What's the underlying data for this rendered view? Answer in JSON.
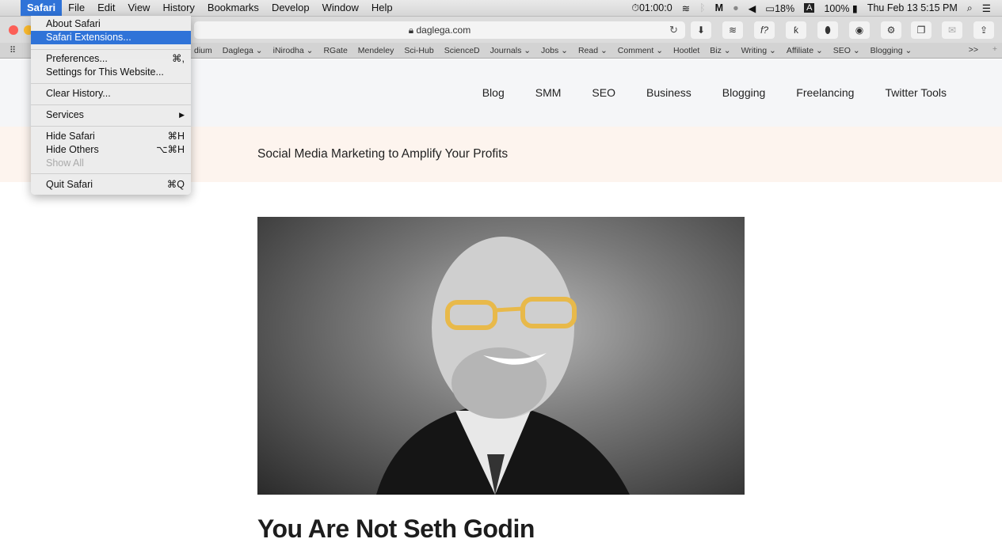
{
  "menubar": {
    "apple": "",
    "items": [
      "Safari",
      "File",
      "Edit",
      "View",
      "History",
      "Bookmarks",
      "Develop",
      "Window",
      "Help"
    ],
    "status": {
      "timer": "01:00:0",
      "cpu": "18%",
      "input": "A",
      "battery": "100%",
      "datetime": "Thu Feb 13  5:15 PM"
    }
  },
  "toolbar": {
    "url": "daglega.com"
  },
  "bookmarks": [
    "dium",
    "Daglega ⌄",
    "iNirodha ⌄",
    "RGate",
    "Mendeley",
    "Sci-Hub",
    "ScienceD",
    "Journals ⌄",
    "Jobs ⌄",
    "Read ⌄",
    "Comment ⌄",
    "Hootlet",
    "Biz ⌄",
    "Writing ⌄",
    "Affiliate ⌄",
    "SEO ⌄",
    "Blogging ⌄"
  ],
  "bookmarks_more": ">>",
  "safari_menu": {
    "about": "About Safari",
    "extensions": "Safari Extensions...",
    "preferences": "Preferences...",
    "preferences_sc": "⌘,",
    "site_settings": "Settings for This Website...",
    "clear_history": "Clear History...",
    "services": "Services",
    "services_arrow": "▶",
    "hide": "Hide Safari",
    "hide_sc": "⌘H",
    "hide_others": "Hide Others",
    "hide_others_sc": "⌥⌘H",
    "show_all": "Show All",
    "quit": "Quit Safari",
    "quit_sc": "⌘Q"
  },
  "site": {
    "nav": [
      "Blog",
      "SMM",
      "SEO",
      "Business",
      "Blogging",
      "Freelancing",
      "Twitter Tools"
    ],
    "tagline": "Social Media Marketing to Amplify Your Profits",
    "post_title": "You Are Not Seth Godin"
  }
}
